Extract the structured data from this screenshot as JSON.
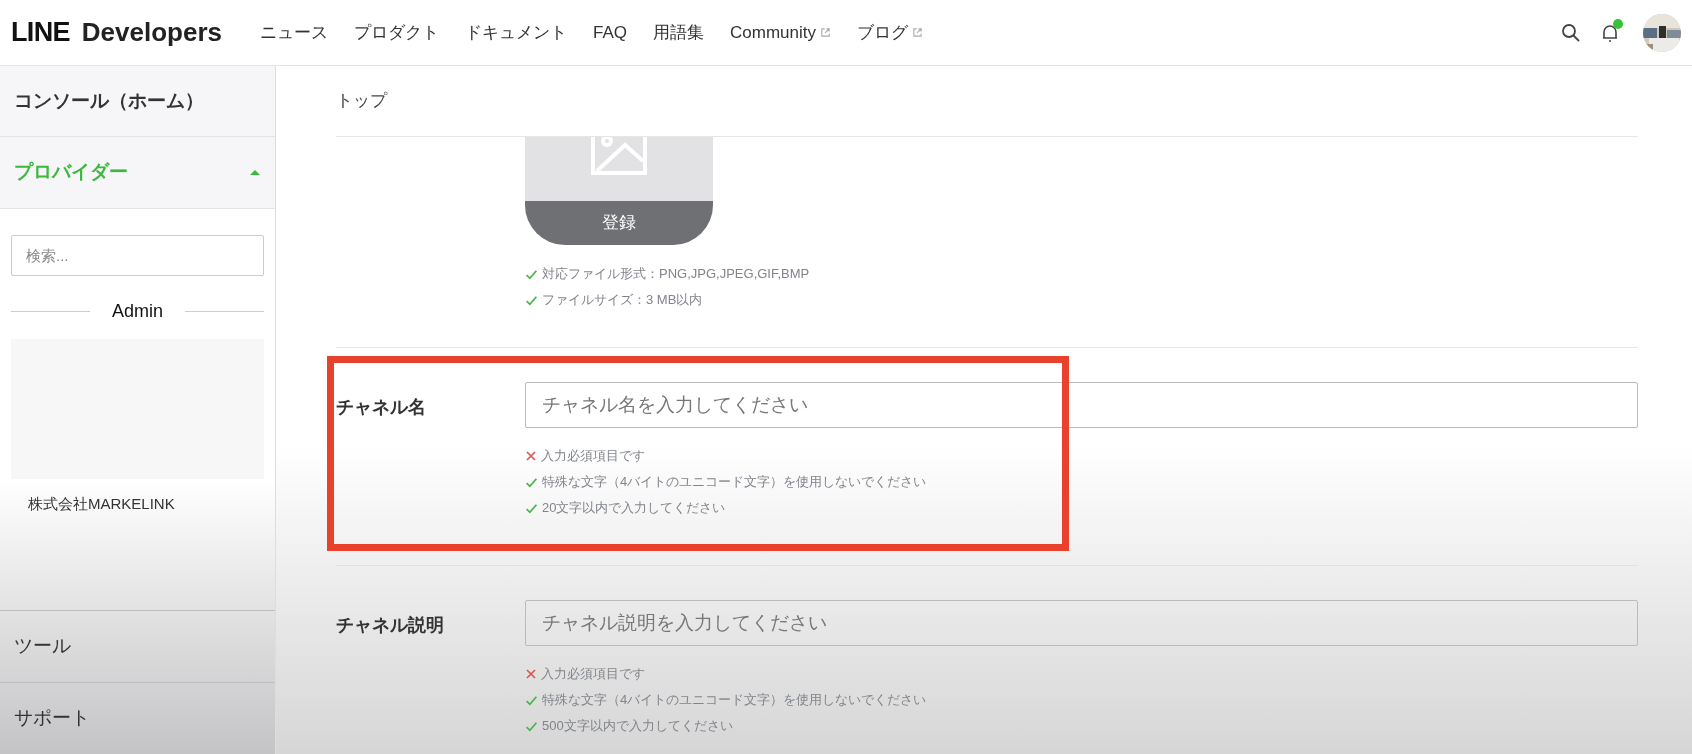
{
  "header": {
    "logo": {
      "brand": "LINE",
      "product": "Developers"
    },
    "nav": [
      {
        "label": "ニュース",
        "external": false
      },
      {
        "label": "プロダクト",
        "external": false
      },
      {
        "label": "ドキュメント",
        "external": false
      },
      {
        "label": "FAQ",
        "external": false
      },
      {
        "label": "用語集",
        "external": false
      },
      {
        "label": "Community",
        "external": true
      },
      {
        "label": "ブログ",
        "external": true
      }
    ],
    "notifications": {
      "unread": true
    }
  },
  "sidebar": {
    "console": "コンソール（ホーム）",
    "provider": {
      "label": "プロバイダー",
      "expanded": true
    },
    "search": {
      "placeholder": "検索..."
    },
    "section": "Admin",
    "providers": [
      {
        "name": "株式会社MARKELINK"
      }
    ],
    "items": [
      "ツール",
      "サポート"
    ]
  },
  "breadcrumb": "トップ",
  "icon_upload": {
    "button": "登録",
    "rules": [
      {
        "text": "対応ファイル形式：PNG,JPG,JPEG,GIF,BMP",
        "ok": true
      },
      {
        "text": "ファイルサイズ：3 MB以内",
        "ok": true
      }
    ]
  },
  "fields": [
    {
      "label": "チャネル名",
      "placeholder": "チャネル名を入力してください",
      "highlighted": true,
      "rules": [
        {
          "text": "入力必須項目です",
          "ok": false
        },
        {
          "text": "特殊な文字（4バイトのユニコード文字）を使用しないでください",
          "ok": true
        },
        {
          "text": "20文字以内で入力してください",
          "ok": true
        }
      ]
    },
    {
      "label": "チャネル説明",
      "placeholder": "チャネル説明を入力してください",
      "highlighted": false,
      "rules": [
        {
          "text": "入力必須項目です",
          "ok": false
        },
        {
          "text": "特殊な文字（4バイトのユニコード文字）を使用しないでください",
          "ok": true
        },
        {
          "text": "500文字以内で入力してください",
          "ok": true
        }
      ]
    }
  ]
}
